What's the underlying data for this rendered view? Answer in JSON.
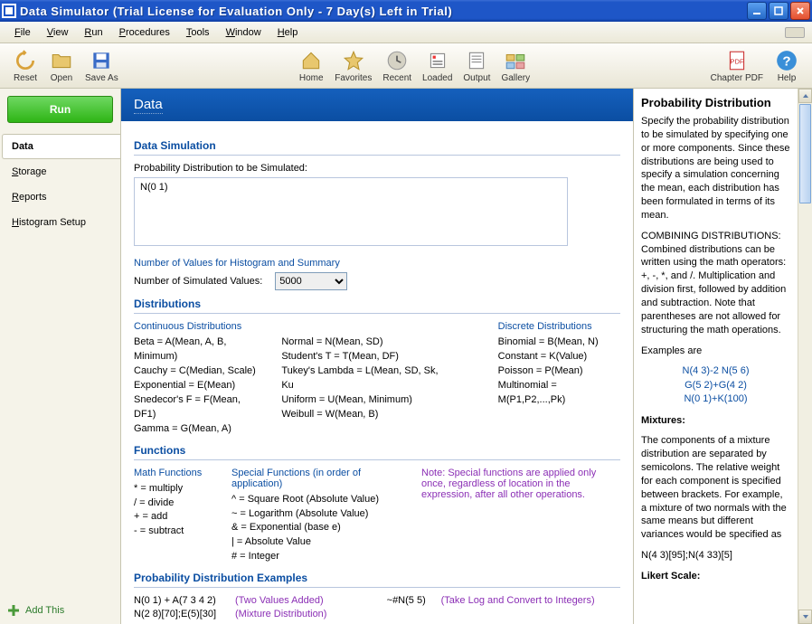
{
  "window": {
    "title": "Data Simulator (Trial License for Evaluation Only - 7 Day(s) Left in Trial)"
  },
  "menubar": {
    "file": "File",
    "view": "View",
    "run": "Run",
    "procedures": "Procedures",
    "tools": "Tools",
    "window": "Window",
    "help": "Help"
  },
  "toolbar": {
    "reset": "Reset",
    "open": "Open",
    "saveas": "Save As",
    "home": "Home",
    "favorites": "Favorites",
    "recent": "Recent",
    "loaded": "Loaded",
    "output": "Output",
    "gallery": "Gallery",
    "chapterpdf": "Chapter PDF",
    "help": "Help"
  },
  "leftpanel": {
    "run_button": "Run",
    "tabs": {
      "data": "Data",
      "storage": "Storage",
      "reports": "Reports",
      "histogram": "Histogram Setup"
    },
    "add_this": "Add This"
  },
  "center": {
    "header": "Data",
    "section1_title": "Data Simulation",
    "dist_label": "Probability Distribution to be Simulated:",
    "dist_value": "N(0 1)",
    "numvals_header": "Number of Values for Histogram and Summary",
    "numvals_label": "Number of Simulated Values:",
    "numvals_selected": "5000",
    "distributions_title": "Distributions",
    "continuous_head": "Continuous Distributions",
    "continuous_left": [
      "Beta = A(Mean, A, B, Minimum)",
      "Cauchy = C(Median, Scale)",
      "Exponential = E(Mean)",
      "Snedecor's F = F(Mean, DF1)",
      "Gamma = G(Mean, A)"
    ],
    "continuous_right": [
      "Normal = N(Mean, SD)",
      "Student's T = T(Mean, DF)",
      "Tukey's Lambda = L(Mean, SD, Sk, Ku",
      "Uniform = U(Mean, Minimum)",
      "Weibull = W(Mean, B)"
    ],
    "discrete_head": "Discrete Distributions",
    "discrete": [
      "Binomial = B(Mean, N)",
      "Constant = K(Value)",
      "Poisson = P(Mean)",
      "Multinomial = M(P1,P2,...,Pk)"
    ],
    "functions_title": "Functions",
    "mathfunc_head": "Math Functions",
    "mathfunc": [
      "* = multiply",
      "/ = divide",
      "+ = add",
      "- = subtract"
    ],
    "specfunc_head": "Special Functions (in order of application)",
    "specfunc": [
      "^ = Square Root (Absolute Value)",
      "~ = Logarithm (Absolute Value)",
      "& = Exponential (base e)",
      "| = Absolute Value",
      "# = Integer"
    ],
    "funcnote": "Note: Special functions are applied only once, regardless of location in the expression, after all other operations.",
    "examples_title": "Probability Distribution Examples",
    "ex1_formula": "N(0 1) + A(7 3 4 2)",
    "ex1_desc": "(Two Values Added)",
    "ex1b_formula": "~#N(5 5)",
    "ex1b_desc": "(Take Log and Convert to Integers)",
    "ex2_formula": "N(2 8)[70];E(5)[30]",
    "ex2_desc": "(Mixture Distribution)"
  },
  "rightpanel": {
    "title": "Probability Distribution",
    "p1": "Specify the probability distribution to be simulated by specifying one or more components. Since these distributions are being used to specify a simulation concerning the mean, each distribution has been formulated in terms of its mean.",
    "p2_head": "COMBINING DISTRIBUTIONS:",
    "p2": "Combined distributions can be written using the math operators: +, -, *, and /. Multiplication and division first, followed by addition and subtraction. Note that parentheses are not allowed for structuring the math operations.",
    "examples_label": "Examples are",
    "ex_lines": [
      "N(4 3)-2 N(5 6)",
      "G(5 2)+G(4 2)",
      "N(0 1)+K(100)"
    ],
    "mixtures_head": "Mixtures:",
    "mixtures_p": "The components of a mixture distribution are separated by semicolons. The relative weight for each component is specified between brackets. For example, a mixture of two normals with the same means but different variances would be specified as",
    "mixtures_ex": "N(4 3)[95];N(4 33)[5]",
    "likert_head": "Likert Scale:"
  }
}
